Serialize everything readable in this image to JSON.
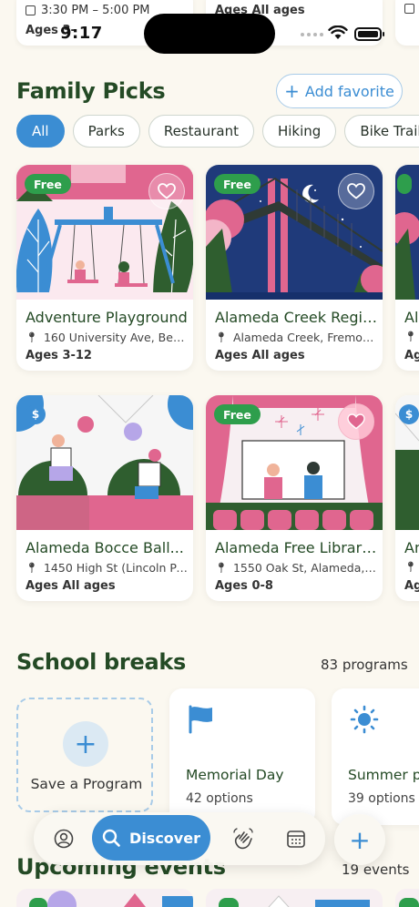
{
  "status": {
    "time": "9:17"
  },
  "top_cards": [
    {
      "time": "3:30 PM – 5:00 PM",
      "ages": "Ages 3-"
    },
    {
      "ages": "Ages All ages"
    }
  ],
  "family_picks": {
    "title": "Family Picks",
    "add_favorite": "Add favorite",
    "filters": [
      "All",
      "Parks",
      "Restaurant",
      "Hiking",
      "Bike Trail"
    ],
    "cards": [
      {
        "badge": "Free",
        "name": "Adventure Playground",
        "address": "160 University Ave, Berk...",
        "ages": "Ages 3-12"
      },
      {
        "badge": "Free",
        "name": "Alameda Creek Regio...",
        "address": "Alameda Creek, Fremont...",
        "ages": "Ages All ages"
      },
      {
        "badge": "$",
        "name": "Alameda Bocce Ball...",
        "address": "1450 High St (Lincoln Pa...",
        "ages": "Ages All ages"
      },
      {
        "badge": "Free",
        "name": "Alameda Free Library...",
        "address": "1550 Oak St, Alameda, C...",
        "ages": "Ages 0-8"
      }
    ],
    "partial_cards": [
      {
        "name": "Ala",
        "ages": "Age"
      },
      {
        "badge": "$",
        "name": "An",
        "ages": "Ag"
      }
    ]
  },
  "school_breaks": {
    "title": "School breaks",
    "count": "83 programs",
    "save_label": "Save a Program",
    "items": [
      {
        "title": "Memorial Day",
        "options": "42 options",
        "icon": "flag-icon"
      },
      {
        "title": "Summer pr",
        "options": "39 options",
        "icon": "sun-icon"
      }
    ]
  },
  "upcoming": {
    "title": "Upcoming events",
    "count": "19 events"
  },
  "tabbar": {
    "discover": "Discover",
    "items": [
      "profile-icon",
      "search-icon",
      "wave-hand-icon",
      "calendar-icon"
    ]
  },
  "colors": {
    "accent": "#3b8dd3",
    "heading": "#244a25",
    "free_badge": "#2e9e4c",
    "background": "#fbf8f0"
  }
}
